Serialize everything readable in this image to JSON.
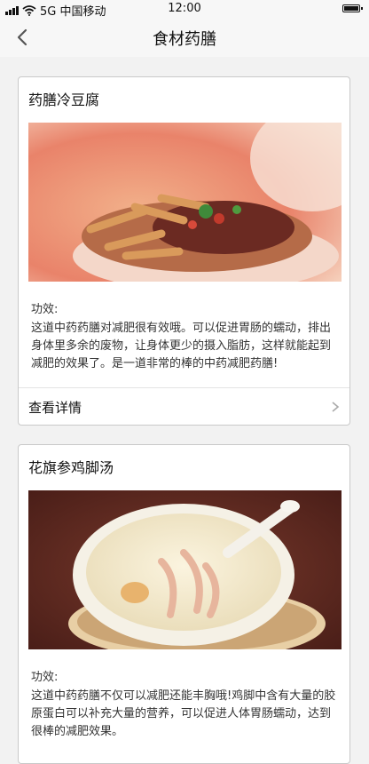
{
  "status_bar": {
    "carrier": "5G 中国移动",
    "time": "12:00",
    "icons": [
      "signal-icon",
      "wifi-icon",
      "battery-icon"
    ]
  },
  "nav": {
    "title": "食材药膳",
    "back_icon": "chevron-left-icon"
  },
  "cards": [
    {
      "title": "药膳冷豆腐",
      "effect_label": "功效:",
      "effect_text": "这道中药药膳对减肥很有效哦。可以促进胃肠的蠕动，排出身体里多余的废物，让身体更少的摄入脂肪，这样就能起到减肥的效果了。是一道非常的棒的中药减肥药膳!",
      "detail_label": "查看详情"
    },
    {
      "title": "花旗参鸡脚汤",
      "effect_label": "功效:",
      "effect_text": "这道中药药膳不仅可以减肥还能丰胸哦!鸡脚中含有大量的胶原蛋白可以补充大量的营养，可以促进人体胃肠蠕动，达到很棒的减肥效果。"
    }
  ],
  "colors": {
    "background": "#f2f2f2",
    "card_border": "#c9c9c9"
  }
}
